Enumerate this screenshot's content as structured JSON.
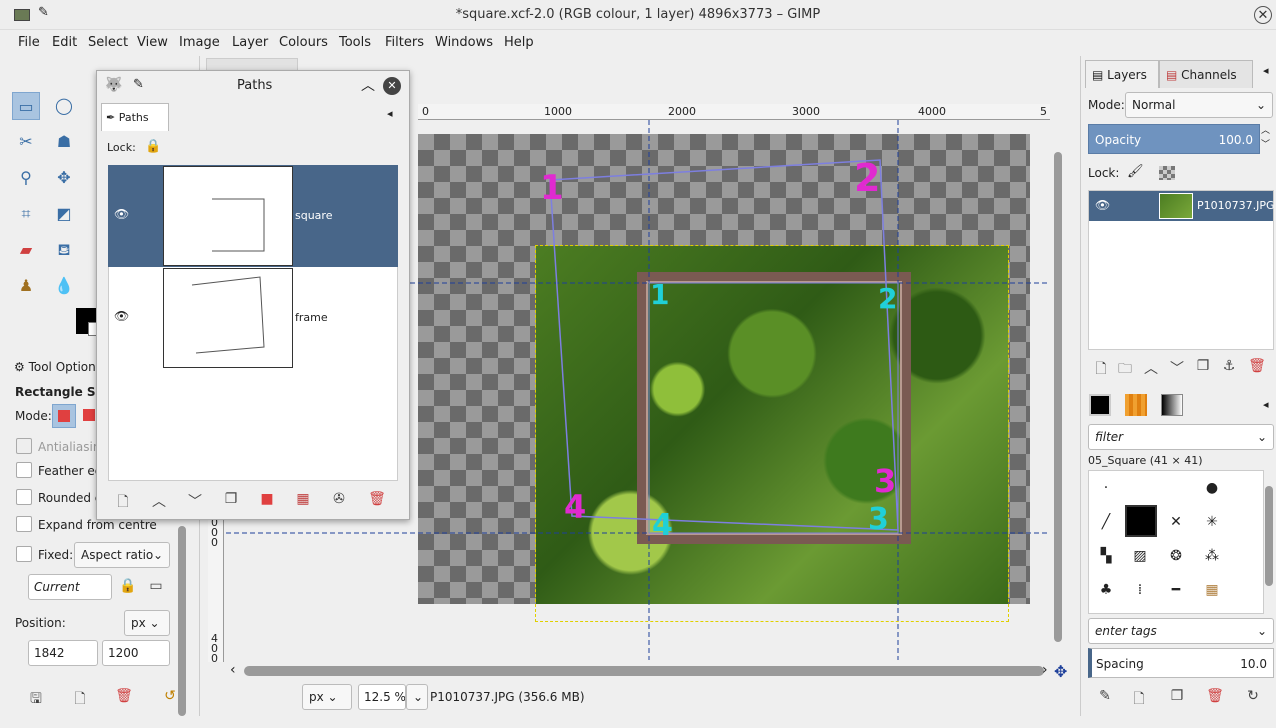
{
  "window": {
    "title": "*square.xcf-2.0 (RGB colour, 1 layer) 4896x3773 – GIMP"
  },
  "menu": [
    "File",
    "Edit",
    "Select",
    "View",
    "Image",
    "Layer",
    "Colours",
    "Tools",
    "Filters",
    "Windows",
    "Help"
  ],
  "paths_dialog": {
    "title": "Paths",
    "tab": "Paths",
    "lock_label": "Lock:",
    "paths": [
      {
        "name": "square",
        "selected": true
      },
      {
        "name": "frame",
        "selected": false
      }
    ]
  },
  "tool_options": {
    "title": "Tool Options",
    "tool_name": "Rectangle Select",
    "mode_label": "Mode:",
    "antialiasing": "Antialiasing",
    "feather": "Feather edges",
    "rounded": "Rounded corners",
    "expand": "Expand from centre",
    "fixed_label": "Fixed:",
    "fixed_value": "Aspect ratio",
    "current": "Current",
    "position_label": "Position:",
    "position_unit": "px",
    "pos_x": "1842",
    "pos_y": "1200"
  },
  "ruler": {
    "h": [
      "0",
      "1000",
      "2000",
      "3000",
      "4000",
      "5"
    ],
    "v": [
      "0",
      "0",
      "0",
      "4",
      "0",
      "0"
    ]
  },
  "canvas_marks": [
    "1",
    "2",
    "3",
    "4",
    "1",
    "2",
    "3",
    "4"
  ],
  "status": {
    "unit": "px",
    "zoom": "12.5 %",
    "info": "P1010737.JPG (356.6 MB)"
  },
  "layers": {
    "tab_layers": "Layers",
    "tab_channels": "Channels",
    "mode_label": "Mode:",
    "mode": "Normal",
    "opacity_label": "Opacity",
    "opacity": "100.0",
    "lock_label": "Lock:",
    "layer_name": "P1010737.JPG"
  },
  "brushes": {
    "filter": "filter",
    "brush_name": "05_Square (41 × 41)",
    "tags": "enter tags",
    "spacing_label": "Spacing",
    "spacing": "10.0"
  }
}
